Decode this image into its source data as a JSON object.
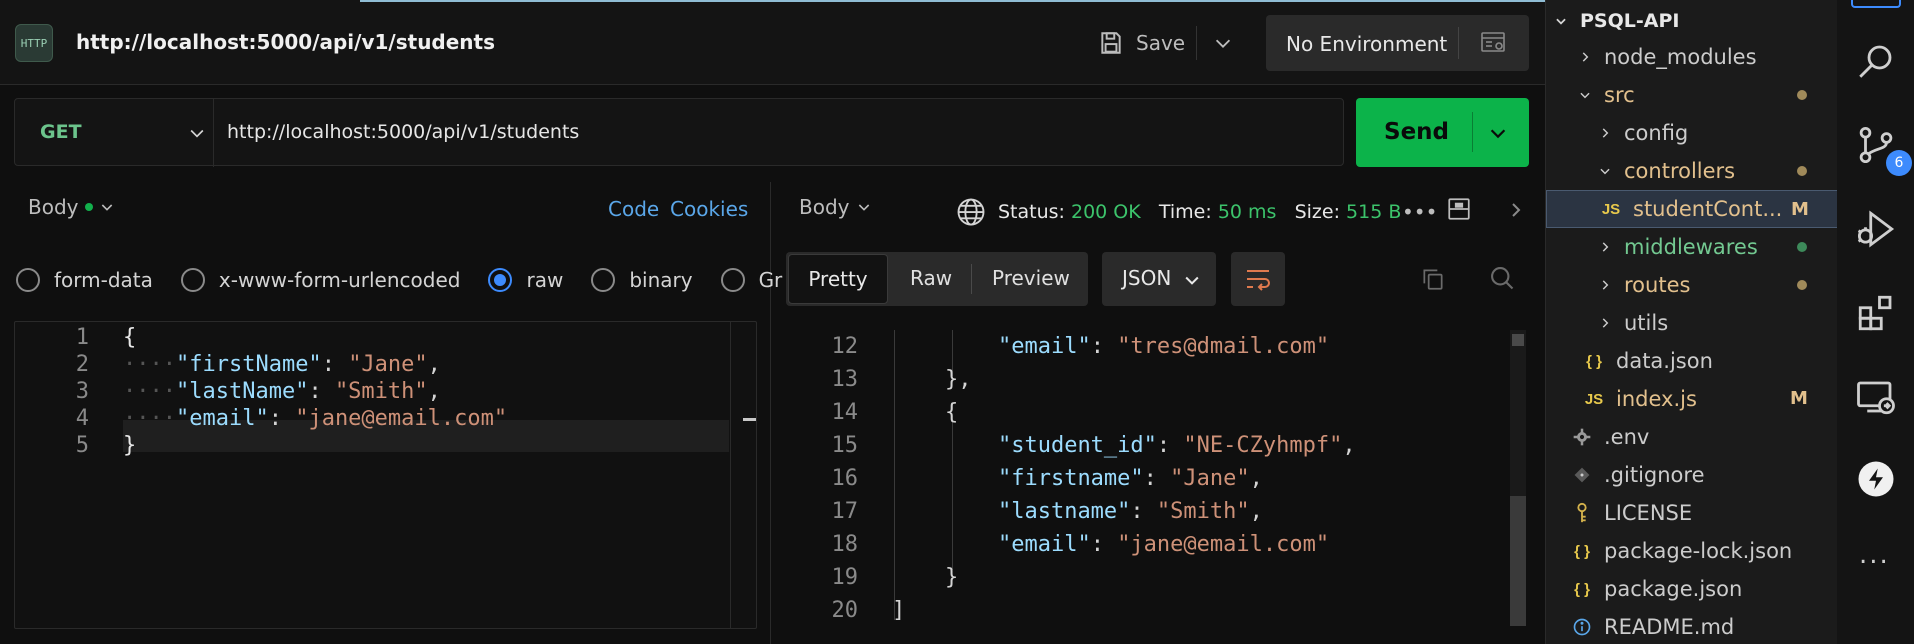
{
  "request": {
    "icon_text": "HTTP",
    "title": "http://localhost:5000/api/v1/students",
    "save_label": "Save",
    "environment": "No Environment",
    "method": "GET",
    "url": "http://localhost:5000/api/v1/students",
    "send_label": "Send"
  },
  "request_body": {
    "tab_label": "Body",
    "code_link": "Code",
    "cookies_link": "Cookies",
    "body_types": [
      {
        "label": "form-data",
        "selected": false
      },
      {
        "label": "x-www-form-urlencoded",
        "selected": false
      },
      {
        "label": "raw",
        "selected": true
      },
      {
        "label": "binary",
        "selected": false
      },
      {
        "label": "Gr",
        "selected": false
      }
    ],
    "line_numbers": [
      "1",
      "2",
      "3",
      "4",
      "5"
    ],
    "lines": {
      "l1": "{",
      "l2_key": "\"firstName\"",
      "l2_val": "\"Jane\"",
      "l3_key": "\"lastName\"",
      "l3_val": "\"Smith\"",
      "l4_key": "\"email\"",
      "l4_val": "\"jane@email.com\"",
      "l5": "}"
    }
  },
  "response": {
    "tab_label": "Body",
    "status_label": "Status:",
    "status_value": "200 OK",
    "time_label": "Time:",
    "time_value": "50 ms",
    "size_label": "Size:",
    "size_value": "515 B",
    "more": "•••",
    "views": [
      "Pretty",
      "Raw",
      "Preview"
    ],
    "format": "JSON",
    "line_numbers": [
      "12",
      "13",
      "14",
      "15",
      "16",
      "17",
      "18",
      "19",
      "20"
    ],
    "lines": {
      "l12_key": "\"email\"",
      "l12_val": "\"tres@dmail.com\"",
      "l13": "},",
      "l14": "{",
      "l15_key": "\"student_id\"",
      "l15_val": "\"NE-CZyhmpf\"",
      "l16_key": "\"firstname\"",
      "l16_val": "\"Jane\"",
      "l17_key": "\"lastname\"",
      "l17_val": "\"Smith\"",
      "l18_key": "\"email\"",
      "l18_val": "\"jane@email.com\"",
      "l19": "}",
      "l20": "]"
    }
  },
  "explorer": {
    "root": "PSQL-API",
    "items": [
      {
        "label": "node_modules",
        "type": "folder",
        "expanded": false
      },
      {
        "label": "src",
        "type": "folder",
        "expanded": true
      },
      {
        "label": "config",
        "type": "folder",
        "expanded": false
      },
      {
        "label": "controllers",
        "type": "folder",
        "expanded": true
      },
      {
        "label": "studentCont...",
        "type": "js",
        "badge": "M"
      },
      {
        "label": "middlewares",
        "type": "folder",
        "expanded": false
      },
      {
        "label": "routes",
        "type": "folder",
        "expanded": false
      },
      {
        "label": "utils",
        "type": "folder",
        "expanded": false
      },
      {
        "label": "data.json",
        "type": "json"
      },
      {
        "label": "index.js",
        "type": "js",
        "badge": "M"
      },
      {
        "label": ".env",
        "type": "gear"
      },
      {
        "label": ".gitignore",
        "type": "git"
      },
      {
        "label": "LICENSE",
        "type": "license"
      },
      {
        "label": "package-lock.json",
        "type": "json"
      },
      {
        "label": "package.json",
        "type": "json"
      },
      {
        "label": "README.md",
        "type": "info"
      }
    ],
    "js_icon_text": "JS",
    "json_icon_text": "{ }"
  },
  "activity_bar": {
    "scm_badge": "6",
    "more": "..."
  },
  "colors": {
    "send_green": "#0cb34a",
    "status_green": "#3cc36b",
    "link_blue": "#5aa6e8",
    "modified_yellow": "#e2c08d",
    "untracked_green": "#73c991"
  }
}
